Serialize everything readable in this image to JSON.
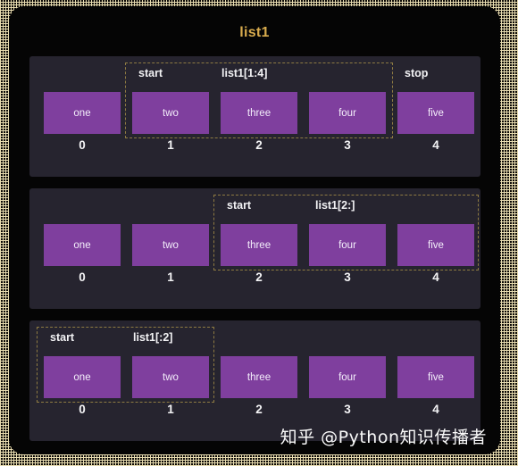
{
  "title": "list1",
  "colors": {
    "accent_gold": "#d9ac4e",
    "dashed_border": "#8e7b42",
    "box_purple": "#7f3f9e",
    "panel_bg": "#26242f",
    "card_bg": "#050505",
    "text": "#f2f2f4"
  },
  "items": [
    {
      "label": "one",
      "index": "0"
    },
    {
      "label": "two",
      "index": "1"
    },
    {
      "label": "three",
      "index": "2"
    },
    {
      "label": "four",
      "index": "3"
    },
    {
      "label": "five",
      "index": "4"
    }
  ],
  "panels": [
    {
      "slice_expression": "list1[1:4]",
      "start_label": "start",
      "stop_label": "stop",
      "range_start": 1,
      "range_end": 3
    },
    {
      "slice_expression": "list1[2:]",
      "start_label": "start",
      "stop_label": "",
      "range_start": 2,
      "range_end": 4
    },
    {
      "slice_expression": "list1[:2]",
      "start_label": "start",
      "stop_label": "",
      "range_start": 0,
      "range_end": 1
    }
  ],
  "watermark": "知乎 @Python知识传播者"
}
